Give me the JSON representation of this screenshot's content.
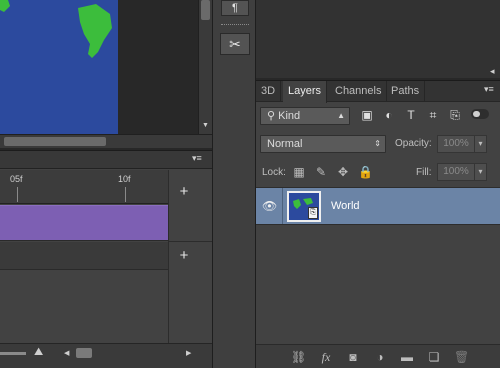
{
  "layers_panel": {
    "tabs": [
      {
        "label": "3D"
      },
      {
        "label": "Layers"
      },
      {
        "label": "Channels"
      },
      {
        "label": "Paths"
      }
    ],
    "filter_kind": "Kind",
    "blend_mode": "Normal",
    "opacity_label": "Opacity:",
    "opacity_value": "100%",
    "lock_label": "Lock:",
    "fill_label": "Fill:",
    "fill_value": "100%",
    "layers": [
      {
        "name": "World",
        "visible": true,
        "selected": true
      }
    ],
    "footer_icons": [
      "link-icon",
      "fx-icon",
      "mask-icon",
      "adjustment-icon",
      "folder-icon",
      "new-layer-icon",
      "trash-icon"
    ]
  },
  "timeline": {
    "ruler_labels": [
      "05f",
      "10f"
    ],
    "add_labels": [
      "+",
      "+"
    ]
  },
  "colors": {
    "canvas_ocean": "#2c4a9e",
    "land": "#3cbd3c",
    "timeline_track": "#7d5fb3",
    "selected_layer": "#6b84a6"
  }
}
